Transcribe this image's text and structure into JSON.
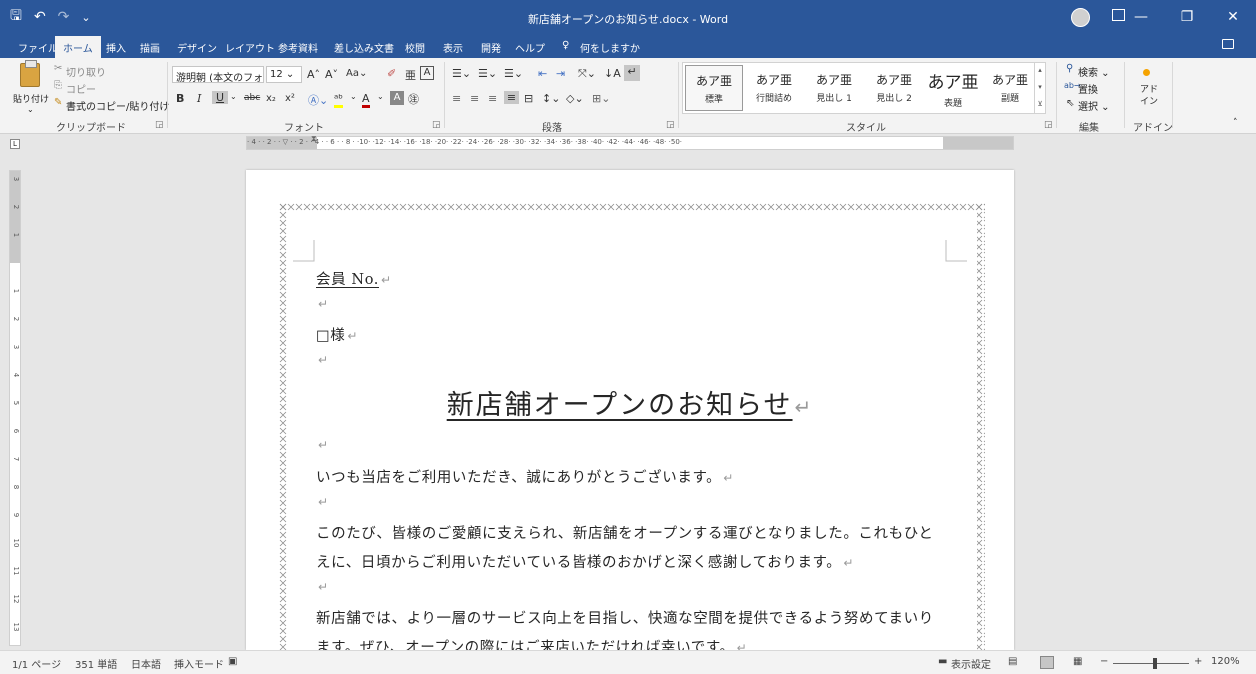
{
  "titlebar": {
    "title": "新店舗オープンのお知らせ.docx - Word",
    "save_icon": "🖫",
    "undo_icon": "↶",
    "redo_icon": "↷",
    "qat_more": "⌄",
    "minimize": "—",
    "restore": "❐",
    "close": "✕"
  },
  "tabs": [
    {
      "label": "ファイル"
    },
    {
      "label": "ホーム"
    },
    {
      "label": "挿入"
    },
    {
      "label": "描画"
    },
    {
      "label": "デザイン"
    },
    {
      "label": "レイアウト"
    },
    {
      "label": "参考資料"
    },
    {
      "label": "差し込み文書"
    },
    {
      "label": "校閲"
    },
    {
      "label": "表示"
    },
    {
      "label": "開発"
    },
    {
      "label": "ヘルプ"
    },
    {
      "label": "何をしますか"
    }
  ],
  "ribbon": {
    "clipboard": {
      "paste": "貼り付け",
      "cut": "切り取り",
      "copy": "コピー",
      "format_painter": "書式のコピー/貼り付け",
      "label": "クリップボード"
    },
    "font": {
      "font_name": "游明朝 (本文のフォン",
      "font_size": "12",
      "label": "フォント"
    },
    "paragraph": {
      "label": "段落"
    },
    "styles": {
      "label": "スタイル",
      "items": [
        {
          "sample": "あア亜",
          "name": "標準"
        },
        {
          "sample": "あア亜",
          "name": "行間詰め"
        },
        {
          "sample": "あア亜",
          "name": "見出し 1"
        },
        {
          "sample": "あア亜",
          "name": "見出し 2"
        },
        {
          "sample": "あア亜",
          "name": "表題"
        },
        {
          "sample": "あア亜",
          "name": "副題"
        }
      ]
    },
    "editing": {
      "search": "検索",
      "replace": "置換",
      "select": "選択",
      "label": "編集"
    },
    "addins": {
      "button": "アド\nイン",
      "label": "アドイン"
    }
  },
  "ruler": {
    "ticks": "· 4 ·  · 2 ·  · ▽ ·  · 2 ·  · 4 ·  · 6 ·  · 8 ·  ·10·  ·12·  ·14·  ·16·  ·18·  ·20·  ·22·  ·24·  ·26·  ·28·  ·30·  ·32·  ·34·  ·36·  ·38·  ·40·  ·42·  ·44·  ·46·  ·48·  ·50· "
  },
  "document": {
    "member_no": "会員 No.",
    "sama": "□様",
    "title": "新店舗オープンのお知らせ",
    "greeting": "いつも当店をご利用いただき、誠にありがとうございます。",
    "para1_line1": "このたび、皆様のご愛顧に支えられ、新店舗をオープンする運びとなりました。これもひと",
    "para1_line2": "えに、日頃からご利用いただいている皆様のおかげと深く感謝しております。",
    "para2_line1": "新店舗では、より一層のサービス向上を目指し、快適な空間を提供できるよう努めてまいり",
    "para2_line2": "ます。ぜひ、オープンの際にはご来店いただければ幸いです。",
    "pilcrow": "↵"
  },
  "statusbar": {
    "page": "1/1 ページ",
    "words": "351 単語",
    "language": "日本語",
    "mode": "挿入モード",
    "display_settings": "表示設定",
    "zoom": "120%"
  }
}
